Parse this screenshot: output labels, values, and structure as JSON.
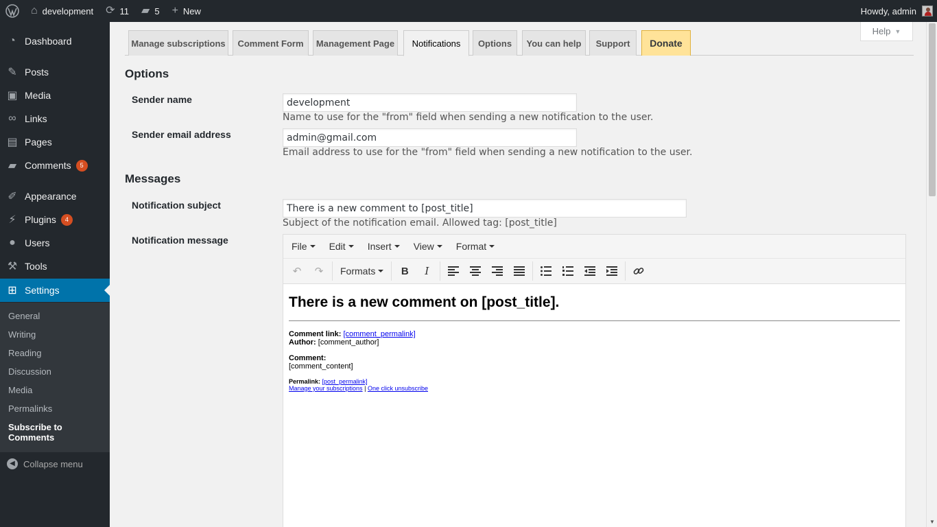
{
  "adminbar": {
    "site_name": "development",
    "updates_count": "11",
    "comments_count": "5",
    "new_label": "New",
    "howdy": "Howdy, admin"
  },
  "sidebar": {
    "items": [
      {
        "label": "Dashboard",
        "icon": "dashboard-icon"
      },
      {
        "label": "Posts",
        "icon": "pin-icon"
      },
      {
        "label": "Media",
        "icon": "media-icon"
      },
      {
        "label": "Links",
        "icon": "link-icon"
      },
      {
        "label": "Pages",
        "icon": "pages-icon"
      },
      {
        "label": "Comments",
        "icon": "comment-icon",
        "badge": "5"
      },
      {
        "label": "Appearance",
        "icon": "brush-icon"
      },
      {
        "label": "Plugins",
        "icon": "plugin-icon",
        "badge": "4"
      },
      {
        "label": "Users",
        "icon": "user-icon"
      },
      {
        "label": "Tools",
        "icon": "wrench-icon"
      },
      {
        "label": "Settings",
        "icon": "settings-icon"
      }
    ],
    "submenu": [
      "General",
      "Writing",
      "Reading",
      "Discussion",
      "Media",
      "Permalinks",
      "Subscribe to Comments"
    ],
    "collapse": "Collapse menu"
  },
  "help_label": "Help",
  "tabs": [
    "Manage subscriptions",
    "Comment Form",
    "Management Page",
    "Notifications",
    "Options",
    "You can help",
    "Support",
    "Donate"
  ],
  "options": {
    "title": "Options",
    "sender_name_label": "Sender name",
    "sender_name_value": "development",
    "sender_name_desc": "Name to use for the \"from\" field when sending a new notification to the user.",
    "sender_email_label": "Sender email address",
    "sender_email_value": "admin@gmail.com",
    "sender_email_desc": "Email address to use for the \"from\" field when sending a new notification to the user."
  },
  "messages": {
    "title": "Messages",
    "subject_label": "Notification subject",
    "subject_value": "There is a new comment to [post_title]",
    "subject_desc": "Subject of the notification email. Allowed tag: [post_title]",
    "message_label": "Notification message"
  },
  "editor": {
    "menus": [
      "File",
      "Edit",
      "Insert",
      "View",
      "Format"
    ],
    "formats_label": "Formats",
    "heading": "There is a new comment on [post_title].",
    "comment_link_label": "Comment link:",
    "comment_link": "[comment_permalink]",
    "author_label": "Author:",
    "author_value": "[comment_author]",
    "comment_label": "Comment:",
    "comment_value": "[comment_content]",
    "permalink_label": "Permalink:",
    "permalink_value": "[post_permalink]",
    "manage_link": "Manage your subscriptions",
    "separator": "|",
    "unsubscribe_link": "One click unsubscribe"
  },
  "colors": {
    "admin_dark": "#23282d",
    "accent_blue": "#0073aa",
    "badge_red": "#d54e21",
    "donate_bg": "#ffe399"
  }
}
